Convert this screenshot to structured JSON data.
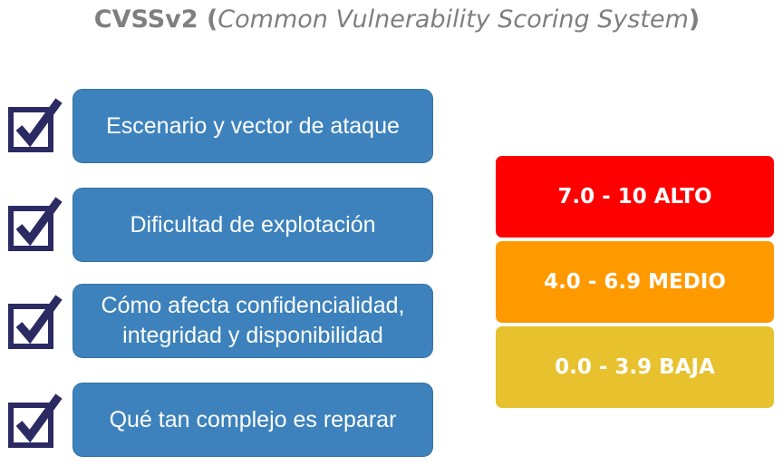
{
  "title": {
    "prefix": "CVSSv2 (",
    "italic": "Common Vulnerability Scoring System",
    "suffix": ")"
  },
  "checklist": {
    "items": [
      {
        "lines": [
          "Escenario y vector de ataque"
        ],
        "icon": "checkbox-checked-icon"
      },
      {
        "lines": [
          "Dificultad de explotación"
        ],
        "icon": "checkbox-checked-icon"
      },
      {
        "lines": [
          "Cómo afecta confidencialidad,",
          "integridad y disponibilidad"
        ],
        "icon": "checkbox-checked-icon"
      },
      {
        "lines": [
          "Qué tan complejo es reparar"
        ],
        "icon": "checkbox-checked-icon"
      }
    ]
  },
  "severity": {
    "levels": [
      {
        "label": "7.0 - 10 ALTO",
        "color": "#ff0000"
      },
      {
        "label": "4.0 - 6.9 MEDIO",
        "color": "#ff9900"
      },
      {
        "label": "0.0 - 3.9 BAJA",
        "color": "#e8c12f"
      }
    ]
  },
  "colors": {
    "item_fill": "#3d82bc",
    "check_mark": "#2c2a63"
  }
}
